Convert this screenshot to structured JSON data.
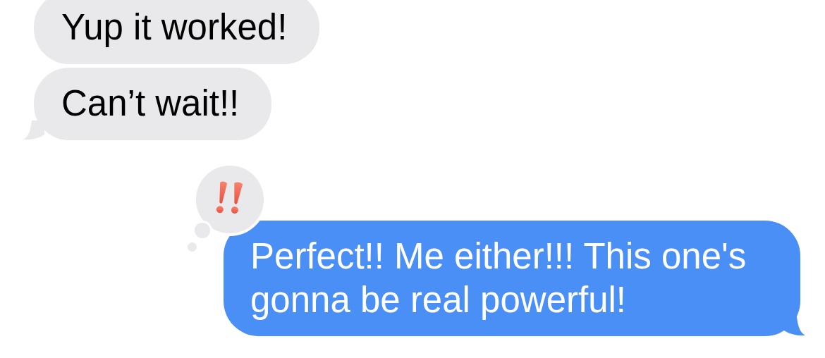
{
  "messages": [
    {
      "kind": "received",
      "text": "Yup it worked!",
      "tail": false
    },
    {
      "kind": "received",
      "text": "Can’t wait!!",
      "tail": true
    },
    {
      "kind": "sent",
      "text": "Perfect!! Me either!!! This one's gonna be real powerful!",
      "tail": true,
      "tapback": {
        "kind": "emphasize"
      }
    }
  ]
}
